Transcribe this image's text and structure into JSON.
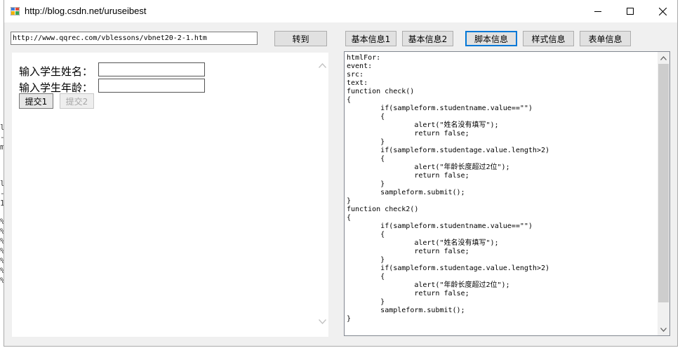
{
  "window": {
    "title": "http://blog.csdn.net/uruseibest"
  },
  "background_window": {
    "chars": [
      "l",
      "-",
      "m",
      "",
      "l",
      "-",
      "1",
      "",
      "%",
      "%",
      "%",
      "%",
      "%",
      "%",
      "%"
    ]
  },
  "toolbar": {
    "url_value": "http://www.qqrec.com/vblessons/vbnet20-2-1.htm",
    "go_label": "转到"
  },
  "tabs": [
    {
      "label": "基本信息1"
    },
    {
      "label": "基本信息2"
    },
    {
      "label": "脚本信息"
    },
    {
      "label": "样式信息"
    },
    {
      "label": "表单信息"
    }
  ],
  "form": {
    "name_label": "输入学生姓名：",
    "age_label": "输入学生年龄：",
    "name_value": "",
    "age_value": "",
    "submit1_label": "提交1",
    "submit2_label": "提交2"
  },
  "script_text": "htmlFor:\nevent:\nsrc:\ntext:\nfunction check()\n{\n\tif(sampleform.studentname.value==\"\")\n\t{\n\t\talert(\"姓名没有填写\");\n\t\treturn false;\n\t}\n\tif(sampleform.studentage.value.length>2)\n\t{\n\t\talert(\"年龄长度超过2位\");\n\t\treturn false;\n\t}\n\tsampleform.submit();\n}\nfunction check2()\n{\n\tif(sampleform.studentname.value==\"\")\n\t{\n\t\talert(\"姓名没有填写\");\n\t\treturn false;\n\t}\n\tif(sampleform.studentage.value.length>2)\n\t{\n\t\talert(\"年龄长度超过2位\");\n\t\treturn false;\n\t}\n\tsampleform.submit();\n}"
}
